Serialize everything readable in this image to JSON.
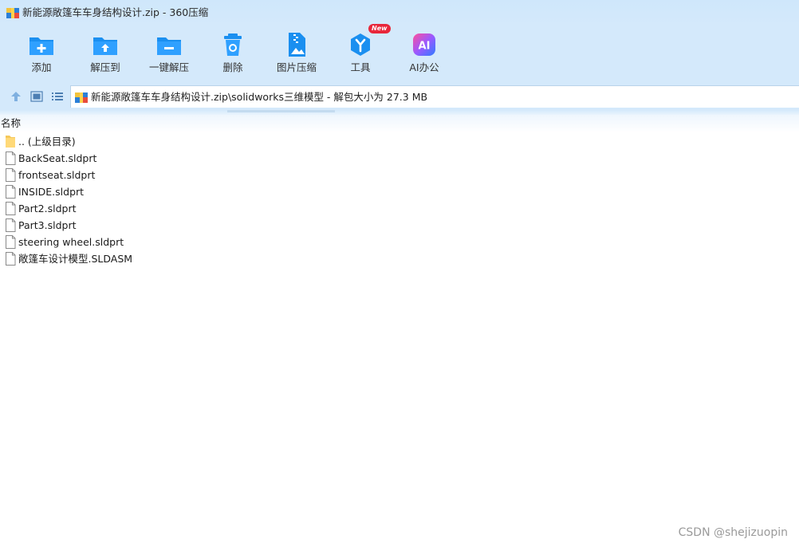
{
  "window": {
    "title": "新能源敞篷车车身结构设计.zip - 360压缩"
  },
  "toolbar": {
    "items": [
      {
        "label": "添加",
        "icon": "add-folder-icon"
      },
      {
        "label": "解压到",
        "icon": "extract-to-icon"
      },
      {
        "label": "一键解压",
        "icon": "one-click-extract-icon"
      },
      {
        "label": "删除",
        "icon": "trash-icon"
      },
      {
        "label": "图片压缩",
        "icon": "image-compress-icon"
      },
      {
        "label": "工具",
        "icon": "tools-icon",
        "badge": "New"
      },
      {
        "label": "AI办公",
        "icon": "ai-office-icon"
      }
    ]
  },
  "address": {
    "path": "新能源敞篷车车身结构设计.zip\\solidworks三维模型 - 解包大小为 27.3 MB"
  },
  "list": {
    "column_name": "名称",
    "files": [
      {
        "name": ".. (上级目录)",
        "type": "folder"
      },
      {
        "name": "BackSeat.sldprt",
        "type": "file"
      },
      {
        "name": "frontseat.sldprt",
        "type": "file"
      },
      {
        "name": "INSIDE.sldprt",
        "type": "file"
      },
      {
        "name": "Part2.sldprt",
        "type": "file"
      },
      {
        "name": "Part3.sldprt",
        "type": "file"
      },
      {
        "name": "steering wheel.sldprt",
        "type": "file"
      },
      {
        "name": "敞篷车设计模型.SLDASM",
        "type": "file"
      }
    ]
  },
  "watermark": "CSDN @shejizuopin",
  "colors": {
    "toolbar_bg": "#d4e9fb",
    "icon_blue": "#1a8ff0",
    "badge_red": "#e8273b",
    "ai_gradient_start": "#ff4f9a",
    "ai_gradient_end": "#2f7bff"
  }
}
